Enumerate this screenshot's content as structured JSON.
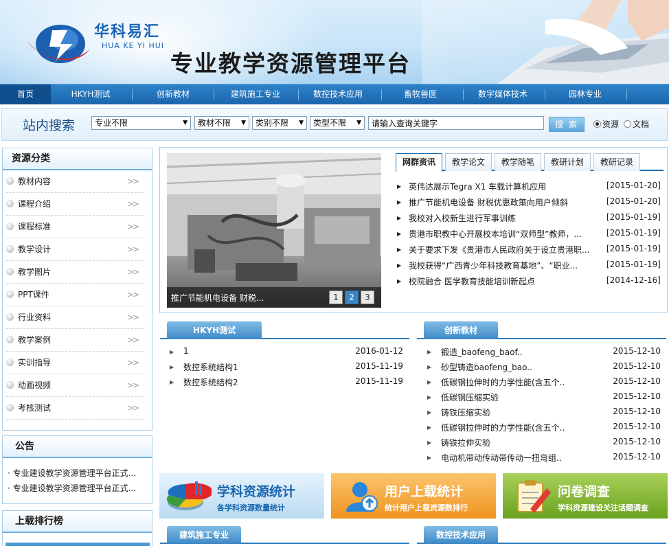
{
  "header": {
    "brand_cn": "华科易汇",
    "brand_en": "HUA KE YI HUI",
    "platform_title": "专业教学资源管理平台"
  },
  "nav": {
    "items": [
      "首页",
      "HKYH测试",
      "创新教材",
      "建筑施工专业",
      "数控技术应用",
      "畜牧兽医",
      "数字媒体技术",
      "园林专业"
    ],
    "active_index": 0
  },
  "search": {
    "label": "站内搜索",
    "filters": [
      "专业不限",
      "教材不限",
      "类别不限",
      "类型不限"
    ],
    "keyword_value": "请输入查询关键字",
    "button": "搜 索",
    "scope_options": [
      "资源",
      "文档"
    ],
    "scope_selected": "资源"
  },
  "sidebar": {
    "categories_title": "资源分类",
    "categories": [
      "教材内容",
      "课程介绍",
      "课程标准",
      "教学设计",
      "教学图片",
      "PPT课件",
      "行业资料",
      "教学案例",
      "实训指导",
      "动画视频",
      "考核测试"
    ],
    "chevron": ">>",
    "notice_title": "公告",
    "notices": [
      "· 专业建设教学资源管理平台正式...",
      "· 专业建设教学资源管理平台正式..."
    ],
    "upload_title": "上载排行榜"
  },
  "slideshow": {
    "caption": "推广节能机电设备 财税...",
    "pages": [
      "1",
      "2",
      "3"
    ],
    "current_page": "2"
  },
  "news": {
    "tabs": [
      "网群资讯",
      "教学论文",
      "教学随笔",
      "教研计划",
      "教研记录"
    ],
    "active_tab": "网群资讯",
    "items": [
      {
        "title": "英伟达展示Tegra X1 车载计算机应用",
        "date": "[2015-01-20]"
      },
      {
        "title": "推广节能机电设备 财税优惠政策向用户倾斜",
        "date": "[2015-01-20]"
      },
      {
        "title": "我校对入校新生进行军事训练",
        "date": "[2015-01-19]"
      },
      {
        "title": "贵港市职教中心开展校本培训“双师型”教师，...",
        "date": "[2015-01-19]"
      },
      {
        "title": "关于要求下发《贵港市人民政府关于设立贵港职...",
        "date": "[2015-01-19]"
      },
      {
        "title": "我校获得“广西青少年科技教育基地”、“职业...",
        "date": "[2015-01-19]"
      },
      {
        "title": "校院融合 医学教育技能培训新起点",
        "date": "[2014-12-16]"
      }
    ]
  },
  "sections": {
    "hkyh": {
      "title": "HKYH测试",
      "items": [
        {
          "title": "1",
          "date": "2016-01-12"
        },
        {
          "title": "数控系统结构1",
          "date": "2015-11-19"
        },
        {
          "title": "数控系统结构2",
          "date": "2015-11-19"
        }
      ]
    },
    "innovation": {
      "title": "创新教材",
      "items": [
        {
          "title": "锻造_baofeng_baof..",
          "date": "2015-12-10"
        },
        {
          "title": "砂型铸造baofeng_bao..",
          "date": "2015-12-10"
        },
        {
          "title": "低碳钢拉伸时的力学性能(含五个..",
          "date": "2015-12-10"
        },
        {
          "title": "低碳钢压缩实验",
          "date": "2015-12-10"
        },
        {
          "title": "铸铁压缩实验",
          "date": "2015-12-10"
        },
        {
          "title": "低碳钢拉伸时的力学性能(含五个..",
          "date": "2015-12-10"
        },
        {
          "title": "铸铁拉伸实验",
          "date": "2015-12-10"
        },
        {
          "title": "电动机带动传动带传动一扭弯组..",
          "date": "2015-12-10"
        }
      ]
    },
    "construction": {
      "title": "建筑施工专业"
    },
    "cnc": {
      "title": "数控技术应用"
    }
  },
  "features": [
    {
      "title": "学科资源统计",
      "sub": "各学科资源数量统计",
      "color": "#1a66b0"
    },
    {
      "title": "用户上载统计",
      "sub": "统计用户上载资源数排行",
      "color": "#ffffff"
    },
    {
      "title": "问卷调查",
      "sub": "学科资源建设关注话题调查",
      "color": "#ffffff"
    }
  ]
}
